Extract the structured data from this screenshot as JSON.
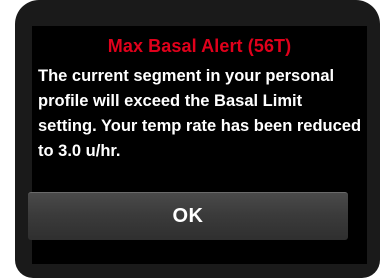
{
  "alert": {
    "title": "Max Basal Alert (56T)",
    "message": "The current segment in your personal profile will exceed the Basal Limit setting. Your temp rate has been reduced to 3.0 u/hr.",
    "ok_label": "OK"
  },
  "colors": {
    "title": "#e0001b",
    "text": "#ffffff",
    "background": "#000000",
    "button": "#3b3b3b"
  }
}
